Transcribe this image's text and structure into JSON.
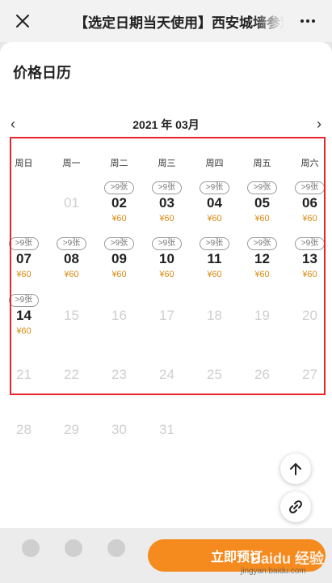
{
  "topbar": {
    "title": "【选定日期当天使用】西安城墙参观票",
    "close_icon": "close-icon",
    "more_icon": "more-icon"
  },
  "sheet": {
    "title": "价格日历",
    "month_label": "2021 年 03月",
    "prev": "‹",
    "next": "›"
  },
  "weekdays": [
    "周日",
    "周一",
    "周二",
    "周三",
    "周四",
    "周五",
    "周六"
  ],
  "calendar": {
    "badge": ">9张",
    "price": "¥60",
    "days": [
      "01",
      "02",
      "03",
      "04",
      "05",
      "06",
      "07",
      "08",
      "09",
      "10",
      "11",
      "12",
      "13",
      "14",
      "15",
      "16",
      "17",
      "18",
      "19",
      "20",
      "21",
      "22",
      "23",
      "24",
      "25",
      "26",
      "27",
      "28",
      "29",
      "30",
      "31"
    ],
    "available_days": [
      "02",
      "03",
      "04",
      "05",
      "06",
      "07",
      "08",
      "09",
      "10",
      "11",
      "12",
      "13",
      "14"
    ]
  },
  "bottom": {
    "buy_label": "立即预订",
    "icons": [
      "home-icon",
      "chat-icon",
      "cart-icon"
    ]
  },
  "watermark": {
    "text": "Baidu 经验",
    "url": "jingyan.baidu.com"
  },
  "colors": {
    "accent": "#f58a1f",
    "price": "#d98a12",
    "highlight": "#e8262a"
  }
}
